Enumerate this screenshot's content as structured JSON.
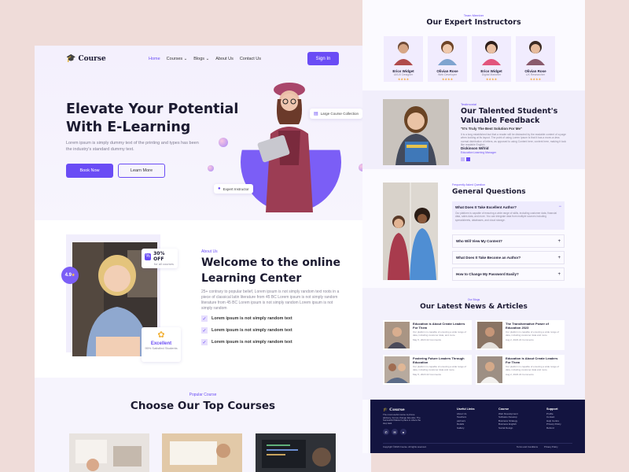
{
  "nav": {
    "logo": "Course",
    "items": [
      "Home",
      "Courses",
      "Blogs",
      "About Us",
      "Contact Us"
    ],
    "signin": "Sign In"
  },
  "hero": {
    "title_line1": "Elevate Your Potential",
    "title_line2": "With E-Learning",
    "desc": "Lorem ipsum is simply dummy text of the printing and types has been the industry's standard dummy text.",
    "btn_book": "Book Now",
    "btn_learn": "Learn More",
    "badge_collection": "Large Course Collection",
    "badge_instructor": "Expert Instructor"
  },
  "about": {
    "tag": "About Us",
    "title_line1": "Welcome to the online",
    "title_line2": "Learning Center",
    "desc": "25+ contrary to popular belief, Lorem ipsum is not simply random text roots in a piece of classical latin literature from 45 BC Lorem ipsum is not simply random literature from 45 BC Lorem ipsum is not simply random Lorem ipsum is not simply random",
    "checks": [
      "Lorem ipsum is not simply random text",
      "Lorem ipsum is not simply random text",
      "Lorem ipsum is not simply random text"
    ],
    "discount": "30% OFF",
    "discount_sub": "for all courses",
    "rating": "4.9",
    "excellent": "Excellent",
    "excellent_sub": "95% Satisfied Students"
  },
  "courses": {
    "tag": "Popular Course",
    "title": "Choose Our Top Courses"
  },
  "instructors": {
    "tag": "Team Member",
    "title": "Our Expert Instructors",
    "items": [
      {
        "name": "Erics Widget",
        "role": "UI/UX Designer",
        "stars": "★★★★"
      },
      {
        "name": "Olivian Rose",
        "role": "Web Developer",
        "stars": "★★★★"
      },
      {
        "name": "Erics Widget",
        "role": "Digital Marketer",
        "stars": "★★★★"
      },
      {
        "name": "Olivian Rose",
        "role": "UX Researcher",
        "stars": "★★★★"
      }
    ]
  },
  "feedback": {
    "tag": "Testimonial",
    "title_line1": "Our Talented Student's",
    "title_line2": "Valuable Feedback",
    "quote": "\"It's Truly The Best Solution For Me\"",
    "text": "It is a long established fact that a reader will be distracted by the readable content of a page when looking at its layout. The point of using Lorem Ipsum is that it has a more-or-less normal distribution of letters, as opposed to using Content here, content here, making it look like readable English.",
    "name": "Dickinson Wifrid",
    "role": "Education Learning Manager"
  },
  "faq": {
    "tag": "Frequently Asked Question",
    "title": "General Questions",
    "items": [
      {
        "q": "What Does It Take Excellent Author?",
        "a": "Our platform is capable of ensuring a wide range of skills, including customer data, financial data, sales data, and more. You can integrate data from multiple sources including spreadsheets, databases, and cloud storage."
      },
      {
        "q": "Who Will View My Content?",
        "a": ""
      },
      {
        "q": "What Does It Take Become an Author?",
        "a": ""
      },
      {
        "q": "How to Change My Password Easily?",
        "a": ""
      }
    ]
  },
  "news": {
    "tag": "Our Blogs",
    "title": "Our Latest News & Articles",
    "items": [
      {
        "title": "Education is About Create Leaders For Them",
        "text": "Our platform is capable of ensuring a wide range of data, including customer data, and more.",
        "meta": "May 5, 2023   22 Comments"
      },
      {
        "title": "The Transformative Power of Education 2023",
        "text": "Our platform is capable of ensuring a wide range of data, including customer data and more.",
        "meta": "Aug 2, 2023   22 Comments"
      },
      {
        "title": "Fostering Future Leaders Through Education",
        "text": "Our platform is capable of ensuring a wide range of data, including customer data and more.",
        "meta": "May 5, 2023   22 Comments"
      },
      {
        "title": "Education is About Create Leaders For Them",
        "text": "Our platform is capable of ensuring a wide range of data, including customer data and more.",
        "meta": "Aug 2, 2023   22 Comments"
      }
    ]
  },
  "footer": {
    "logo": "Course",
    "desc": "The most useful course is phone advisory, but we change fate also. The Successful Master's place is where the step task.",
    "cols": [
      {
        "title": "Useful Links",
        "items": [
          "About Us",
          "Teachers",
          "partners",
          "Details",
          "Gallery"
        ]
      },
      {
        "title": "Course",
        "items": [
          "Web Development",
          "Software Develop",
          "Business Strategy",
          "Business English",
          "Social Design"
        ]
      },
      {
        "title": "Support",
        "items": [
          "Profile",
          "Contact",
          "Help Centre",
          "Privacy Policy",
          "Refund"
        ]
      }
    ],
    "copyright": "Copyright ©2023 Course. All rights reserved.",
    "links": [
      "Terms and Conditions",
      "Privacy Policy"
    ]
  },
  "colors": {
    "accent": "#6a4cf5",
    "footer": "#131440",
    "bg": "#efdcd9"
  }
}
